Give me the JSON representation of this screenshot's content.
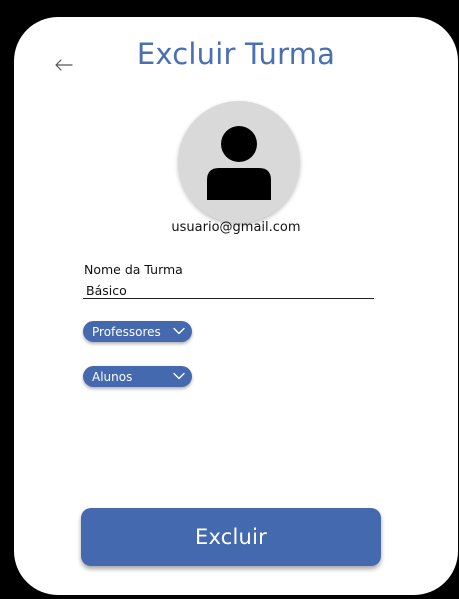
{
  "header": {
    "title": "Excluir Turma",
    "back_icon": "arrow-left-icon"
  },
  "profile": {
    "avatar_icon": "user-icon",
    "email": "usuario@gmail.com"
  },
  "form": {
    "class_name_label": "Nome da Turma",
    "class_name_value": "Básico",
    "teachers_dropdown": {
      "selected": "Professores",
      "icon": "chevron-down-icon"
    },
    "students_dropdown": {
      "selected": "Alunos",
      "icon": "chevron-down-icon"
    }
  },
  "actions": {
    "delete_label": "Excluir"
  },
  "colors": {
    "accent": "#4469ae",
    "title": "#4a6fb2",
    "avatar_bg": "#d9d9d9",
    "background": "#ffffff",
    "frame": "#000000"
  }
}
